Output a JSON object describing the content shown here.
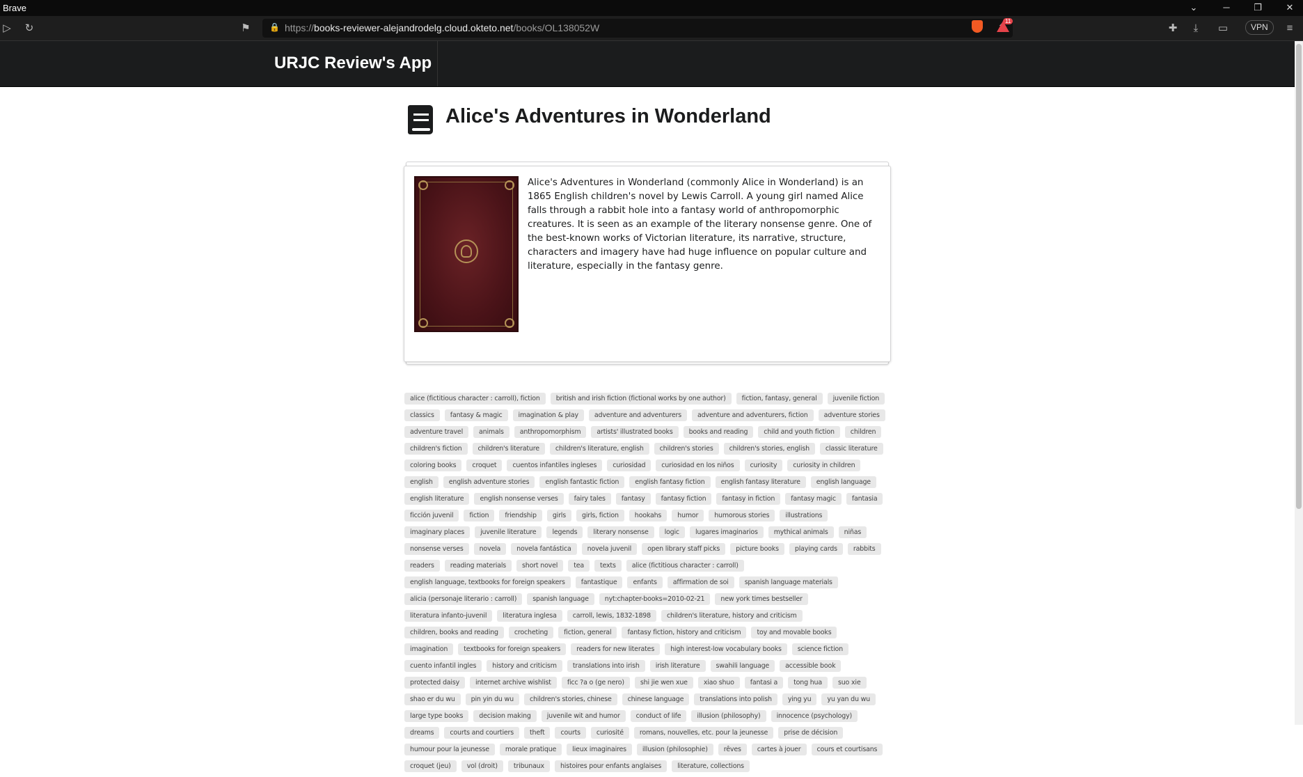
{
  "browser": {
    "app_name": "Brave",
    "url_prefix": "https://",
    "url_host": "books-reviewer-alejandrodelg.cloud.okteto.net",
    "url_path": "/books/OL138052W",
    "alert_count": "11",
    "vpn_label": "VPN"
  },
  "navbar": {
    "brand": "URJC Review's App"
  },
  "book": {
    "title": "Alice's Adventures in Wonderland",
    "description": "Alice's Adventures in Wonderland (commonly Alice in Wonderland) is an 1865 English children's novel by Lewis Carroll. A young girl named Alice falls through a rabbit hole into a fantasy world of anthropomorphic creatures. It is seen as an example of the literary nonsense genre. One of the best-known works of Victorian literature, its narrative, structure, characters and imagery have had huge influence on popular culture and literature, especially in the fantasy genre."
  },
  "subjects": [
    "alice (fictitious character : carroll), fiction",
    "british and irish fiction (fictional works by one author)",
    "fiction, fantasy, general",
    "juvenile fiction",
    "classics",
    "fantasy & magic",
    "imagination & play",
    "adventure and adventurers",
    "adventure and adventurers, fiction",
    "adventure stories",
    "adventure travel",
    "animals",
    "anthropomorphism",
    "artists' illustrated books",
    "books and reading",
    "child and youth fiction",
    "children",
    "children's fiction",
    "children's literature",
    "children's literature, english",
    "children's stories",
    "children's stories, english",
    "classic literature",
    "coloring books",
    "croquet",
    "cuentos infantiles ingleses",
    "curiosidad",
    "curiosidad en los niños",
    "curiosity",
    "curiosity in children",
    "english",
    "english adventure stories",
    "english fantastic fiction",
    "english fantasy fiction",
    "english fantasy literature",
    "english language",
    "english literature",
    "english nonsense verses",
    "fairy tales",
    "fantasy",
    "fantasy fiction",
    "fantasy in fiction",
    "fantasy magic",
    "fantasia",
    "ficción juvenil",
    "fiction",
    "friendship",
    "girls",
    "girls, fiction",
    "hookahs",
    "humor",
    "humorous stories",
    "illustrations",
    "imaginary places",
    "juvenile literature",
    "legends",
    "literary nonsense",
    "logic",
    "lugares imaginarios",
    "mythical animals",
    "niñas",
    "nonsense verses",
    "novela",
    "novela fantástica",
    "novela juvenil",
    "open library staff picks",
    "picture books",
    "playing cards",
    "rabbits",
    "readers",
    "reading materials",
    "short novel",
    "tea",
    "texts",
    "alice (fictitious character : carroll)",
    "english language, textbooks for foreign speakers",
    "fantastique",
    "enfants",
    "affirmation de soi",
    "spanish language materials",
    "alicia (personaje literario : carroll)",
    "spanish language",
    "nyt:chapter-books=2010-02-21",
    "new york times bestseller",
    "literatura infanto-juvenil",
    "literatura inglesa",
    "carroll, lewis, 1832-1898",
    "children's literature, history and criticism",
    "children, books and reading",
    "crocheting",
    "fiction, general",
    "fantasy fiction, history and criticism",
    "toy and movable books",
    "imagination",
    "textbooks for foreign speakers",
    "readers for new literates",
    "high interest-low vocabulary books",
    "science fiction",
    "cuento infantil ingles",
    "history and criticism",
    "translations into irish",
    "irish literature",
    "swahili language",
    "accessible book",
    "protected daisy",
    "internet archive wishlist",
    "ficc ?a o (ge nero)",
    "shi jie wen xue",
    "xiao shuo",
    "fantasi a",
    "tong hua",
    "suo xie",
    "shao er du wu",
    "pin yin du wu",
    "children's stories, chinese",
    "chinese language",
    "translations into polish",
    "ying yu",
    "yu yan du wu",
    "large type books",
    "decision making",
    "juvenile wit and humor",
    "conduct of life",
    "illusion (philosophy)",
    "innocence (psychology)",
    "dreams",
    "courts and courtiers",
    "theft",
    "courts",
    "curiosité",
    "romans, nouvelles, etc. pour la jeunesse",
    "prise de décision",
    "humour pour la jeunesse",
    "morale pratique",
    "lieux imaginaires",
    "illusion (philosophie)",
    "rêves",
    "cartes à jouer",
    "cours et courtisans",
    "croquet (jeu)",
    "vol (droit)",
    "tribunaux",
    "histoires pour enfants anglaises",
    "literature, collections"
  ]
}
